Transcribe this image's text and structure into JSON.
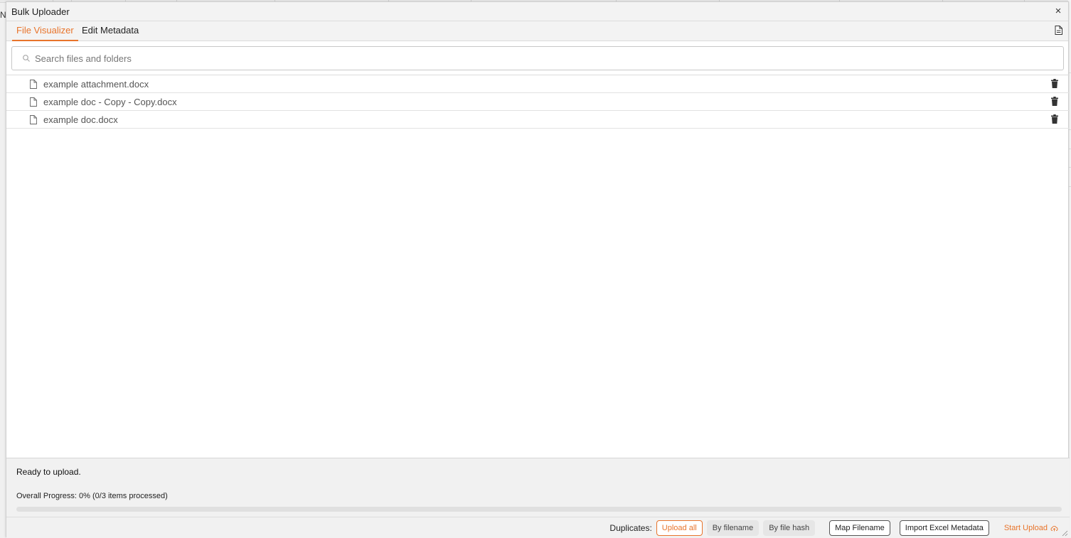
{
  "window": {
    "title": "Bulk Uploader",
    "close_glyph": "×"
  },
  "tabs": [
    {
      "label": "File Visualizer",
      "active": true
    },
    {
      "label": "Edit Metadata",
      "active": false
    }
  ],
  "toolbar_icon": "document-icon",
  "search": {
    "placeholder": "Search files and folders",
    "value": ""
  },
  "files": [
    {
      "name": "example attachment.docx",
      "icon": "file-icon",
      "action_icon": "trash-icon"
    },
    {
      "name": "example doc - Copy - Copy.docx",
      "icon": "file-icon",
      "action_icon": "trash-icon"
    },
    {
      "name": "example doc.docx",
      "icon": "file-icon",
      "action_icon": "trash-icon"
    }
  ],
  "footer": {
    "status": "Ready to upload.",
    "progress_label": "Overall Progress: 0% (0/3 items processed)",
    "progress_fraction": 0,
    "duplicates_label": "Duplicates:",
    "duplicate_options": [
      {
        "label": "Upload all",
        "selected": true
      },
      {
        "label": "By filename",
        "selected": false
      },
      {
        "label": "By file hash",
        "selected": false
      }
    ],
    "map_filename_label": "Map Filename",
    "import_excel_label": "Import Excel Metadata",
    "start_upload_label": "Start Upload",
    "start_upload_icon": "cloud-upload-icon"
  },
  "colors": {
    "accent": "#e8742b",
    "title_bar": "#f3f3f3",
    "footer": "#f1f1f1"
  }
}
